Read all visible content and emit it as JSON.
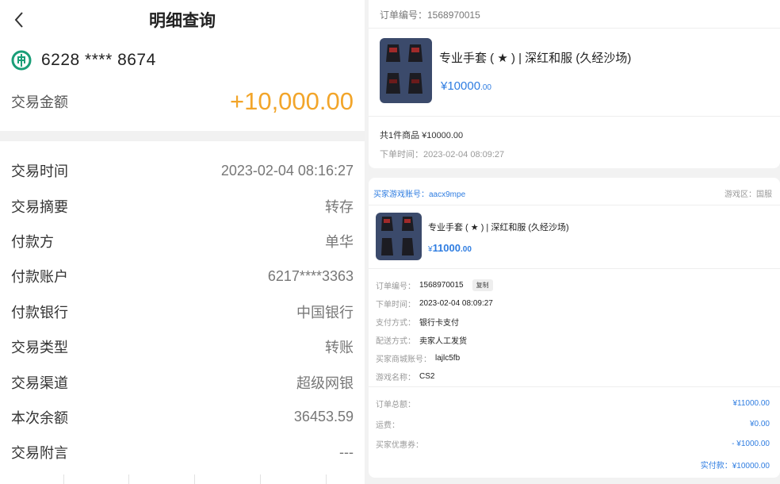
{
  "left": {
    "title": "明细查询",
    "card_number": "6228 **** 8674",
    "amount_label": "交易金额",
    "amount_value": "+10,000.00",
    "details": [
      {
        "label": "交易时间",
        "value": "2023-02-04 08:16:27"
      },
      {
        "label": "交易摘要",
        "value": "转存"
      },
      {
        "label": "付款方",
        "value": "单华"
      },
      {
        "label": "付款账户",
        "value": "6217****3363"
      },
      {
        "label": "付款银行",
        "value": "中国银行"
      },
      {
        "label": "交易类型",
        "value": "转账"
      },
      {
        "label": "交易渠道",
        "value": "超级网银"
      },
      {
        "label": "本次余额",
        "value": "36453.59"
      },
      {
        "label": "交易附言",
        "value": "---"
      }
    ]
  },
  "order_card": {
    "order_no": "订单编号：1568970015",
    "product_name": "专业手套 ( ★ ) | 深红和服 (久经沙场)",
    "price_main": "¥10000",
    "price_dec": ".00",
    "summary": "共1件商品   ¥10000.00",
    "order_time": "下单时间：2023-02-04 08:09:27"
  },
  "detail_card": {
    "buyer_account": "买家游戏账号：aacx9mpe",
    "region": "游戏区：国服",
    "product_name": "专业手套 ( ★ ) | 深红和服 (久经沙场)",
    "price_yen": "¥",
    "price_main": "11000",
    "price_dec": ".00",
    "info": [
      {
        "label": "订单编号：",
        "value": "1568970015",
        "copy": "复制"
      },
      {
        "label": "下单时间：",
        "value": "2023-02-04 08:09:27"
      },
      {
        "label": "支付方式：",
        "value": "银行卡支付"
      },
      {
        "label": "配送方式：",
        "value": "卖家人工发货"
      },
      {
        "label": "买家商城账号：",
        "value": "lajlc5fb"
      },
      {
        "label": "游戏名称：",
        "value": "CS2"
      }
    ],
    "totals": [
      {
        "label": "订单总额：",
        "value": "¥11000.00"
      },
      {
        "label": "运费：",
        "value": "¥0.00"
      },
      {
        "label": "买家优惠券：",
        "value": "- ¥1000.00"
      }
    ],
    "paid": "实付款：¥10000.00"
  },
  "colors": {
    "accent_amount": "#f2a52a",
    "link_blue": "#2f7de1",
    "bank_green": "#1a9e78"
  },
  "icons": {
    "back": "chevron-left-icon",
    "bank": "abc-bank-logo-icon",
    "product": "glove-product-image"
  }
}
